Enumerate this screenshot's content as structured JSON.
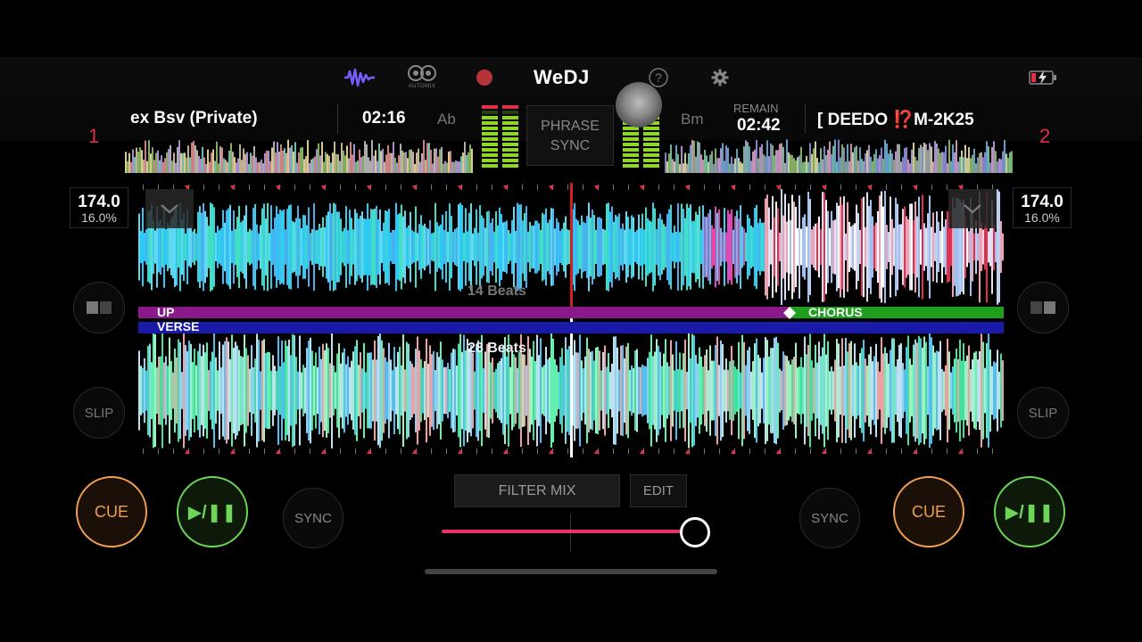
{
  "app": {
    "brand": "WeDJ"
  },
  "topbar": {
    "icons": [
      "waveform-icon",
      "automix-icon",
      "record-icon",
      "help-icon",
      "gear-icon",
      "battery-icon"
    ],
    "automix_label": "AUTOMIX",
    "help_glyph": "?"
  },
  "deck1": {
    "number": "1",
    "title": "ex Bsv (Private)",
    "time": "02:16",
    "key": "Ab",
    "bpm": "174.0",
    "pitch": "16.0%",
    "cue": "CUE",
    "play": "▶/❚❚",
    "sync": "SYNC",
    "slip": "SLIP",
    "beats": "14 Beats",
    "phrase_top": "UP",
    "phrase_bottom": "VERSE"
  },
  "deck2": {
    "number": "2",
    "title": "[ DEEDO ⁉️M-2K25",
    "remain_label": "REMAIN",
    "remain_time": "02:42",
    "key": "Bm",
    "bpm": "174.0",
    "pitch": "16.0%",
    "cue": "CUE",
    "play": "▶/❚❚",
    "sync": "SYNC",
    "slip": "SLIP",
    "beats": "28 Beats",
    "phrase": "CHORUS"
  },
  "center": {
    "phrase_sync_line1": "PHRASE",
    "phrase_sync_line2": "SYNC",
    "filter_mix": "FILTER MIX",
    "edit": "EDIT",
    "crossfader_position": 1.0
  },
  "colors": {
    "accent_red": "#e0304a",
    "cue_orange": "#f0a050",
    "play_green": "#6ed45a",
    "phrase_purple": "#8a1a8a",
    "phrase_blue": "#1a1aa8",
    "phrase_green": "#1ea01e",
    "crossfader_pink": "#e8336a"
  }
}
